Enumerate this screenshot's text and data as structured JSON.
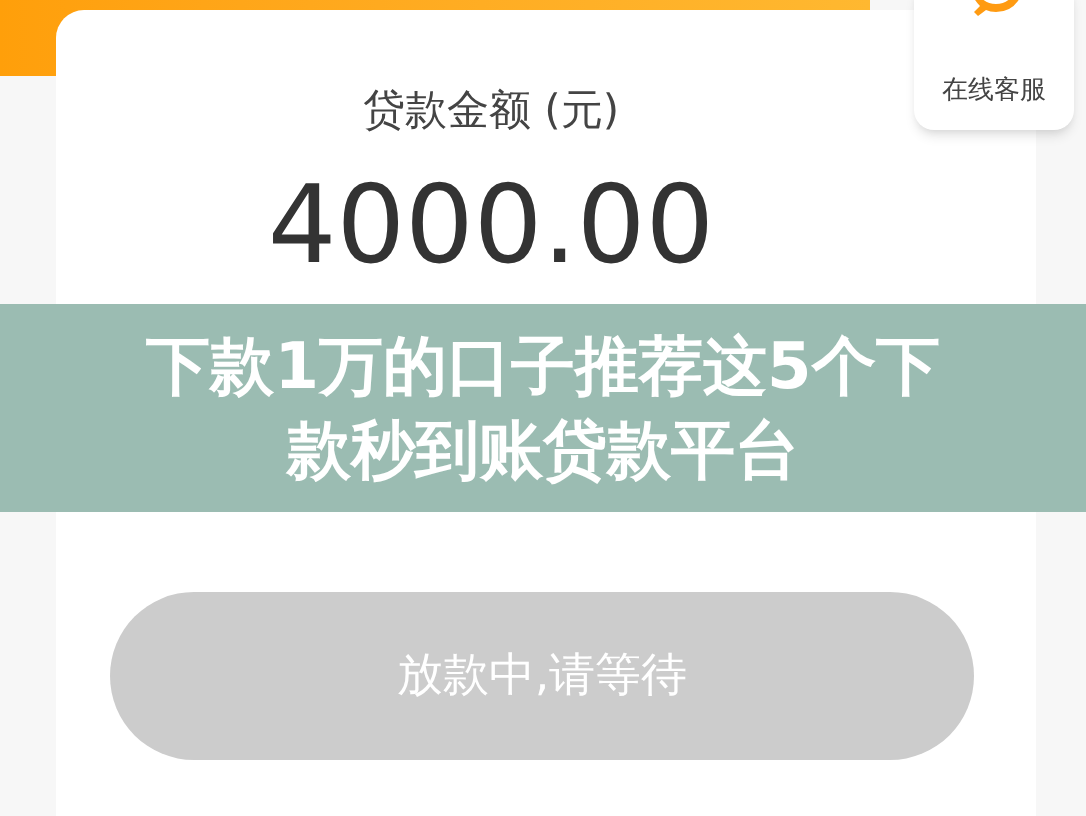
{
  "card": {
    "label": "贷款金额 (元)",
    "amount": "4000.00"
  },
  "service": {
    "label": "在线客服"
  },
  "banner": {
    "title": "下款1万的口子推荐这5个下款秒到账贷款平台"
  },
  "button": {
    "label": "放款中,请等待",
    "disabled": true
  }
}
